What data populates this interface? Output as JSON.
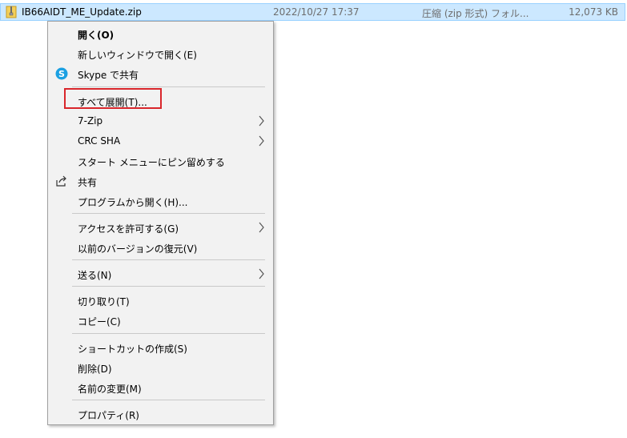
{
  "file": {
    "name": "IB66AIDT_ME_Update.zip",
    "date": "2022/10/27 17:37",
    "type": "圧縮 (zip 形式) フォル...",
    "size": "12,073 KB",
    "icon": "zip-folder-icon"
  },
  "menu": {
    "items": [
      {
        "label": "開く(O)"
      },
      {
        "label": "新しいウィンドウで開く(E)"
      },
      {
        "label": "Skype で共有",
        "icon": "skype-icon"
      },
      {
        "label": "すべて展開(T)..."
      },
      {
        "label": "7-Zip"
      },
      {
        "label": "CRC SHA"
      },
      {
        "label": "スタート メニューにピン留めする"
      },
      {
        "label": "共有",
        "icon": "share-icon"
      },
      {
        "label": "プログラムから開く(H)..."
      },
      {
        "label": "アクセスを許可する(G)"
      },
      {
        "label": "以前のバージョンの復元(V)"
      },
      {
        "label": "送る(N)"
      },
      {
        "label": "切り取り(T)"
      },
      {
        "label": "コピー(C)"
      },
      {
        "label": "ショートカットの作成(S)"
      },
      {
        "label": "削除(D)"
      },
      {
        "label": "名前の変更(M)"
      },
      {
        "label": "プロパティ(R)"
      }
    ]
  },
  "colors": {
    "selection": "#cce8ff",
    "menu_background": "#f2f2f2",
    "highlight_box": "#d9262b",
    "skype": "#1ba0e2"
  }
}
